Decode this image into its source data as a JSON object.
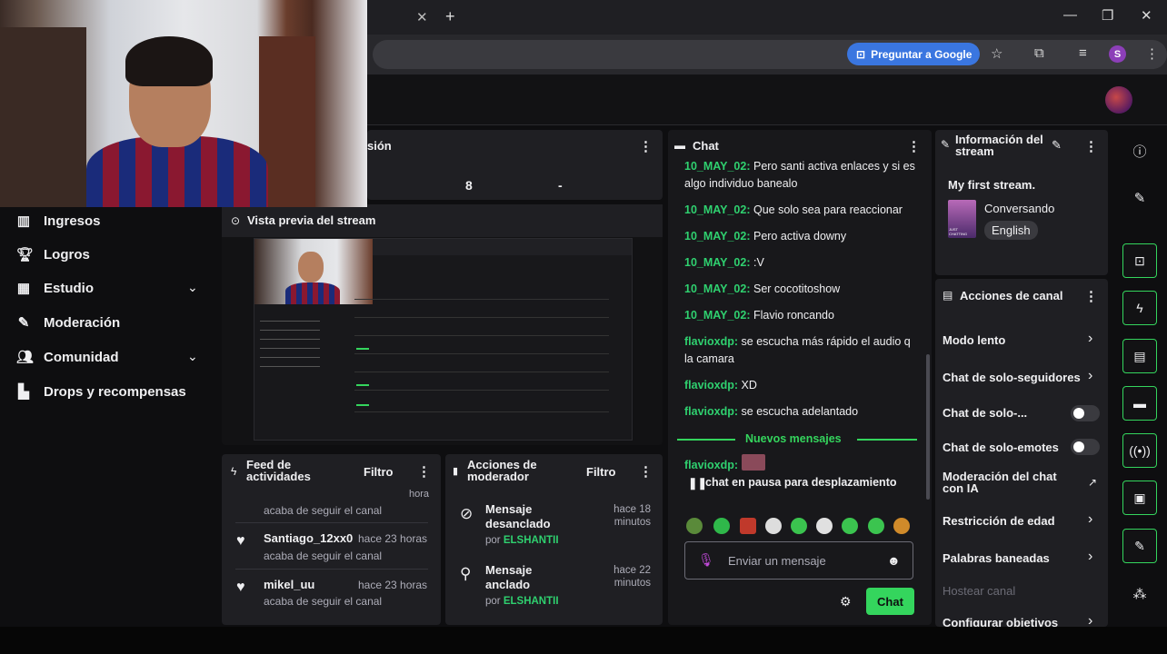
{
  "browser": {
    "tab_close": "✕",
    "tab_new": "+",
    "ask_google": "Preguntar a Google",
    "profile_initial": "S",
    "win_minimize": "—",
    "win_restore": "❐",
    "win_close": "✕"
  },
  "nav": {
    "items": [
      {
        "label": "Ingresos",
        "icon": "bar-chart-icon"
      },
      {
        "label": "Logros",
        "icon": "trophy-icon"
      },
      {
        "label": "Estudio",
        "icon": "studio-icon"
      },
      {
        "label": "Moderación",
        "icon": "wrench-icon"
      },
      {
        "label": "Comunidad",
        "icon": "people-icon"
      },
      {
        "label": "Drops y recompensas",
        "icon": "gift-icon"
      }
    ]
  },
  "session": {
    "title_partial": "sión",
    "stat_a": "8",
    "stat_b": "-"
  },
  "preview": {
    "title": "Vista previa del stream"
  },
  "feed": {
    "title": "Feed de actividades",
    "filter": "Filtro",
    "truncated_time": "hora",
    "first_sub": "acaba de seguir el canal",
    "items": [
      {
        "name": "Santiago_12xx0",
        "time": "hace 23 horas",
        "sub": "acaba de seguir el canal"
      },
      {
        "name": "mikel_uu",
        "time": "hace 23 horas",
        "sub": "acaba de seguir el canal"
      }
    ]
  },
  "modactions": {
    "title": "Acciones de moderador",
    "filter": "Filtro",
    "items": [
      {
        "action": "Mensaje desanclado",
        "time": "hace 18 minutos",
        "by": "por",
        "user": "ELSHANTII"
      },
      {
        "action": "Mensaje anclado",
        "time": "hace 22 minutos",
        "by": "por",
        "user": "ELSHANTII"
      }
    ]
  },
  "chat": {
    "title": "Chat",
    "messages": [
      {
        "name": "10_MAY_02",
        "text": "Pero santi activa enlaces y si es algo individuo banealo"
      },
      {
        "name": "10_MAY_02",
        "text": "Que solo sea para reaccionar"
      },
      {
        "name": "10_MAY_02",
        "text": "Pero activa downy"
      },
      {
        "name": "10_MAY_02",
        "text": ":V"
      },
      {
        "name": "10_MAY_02",
        "text": "Ser cocotitoshow"
      },
      {
        "name": "10_MAY_02",
        "text": "Flavio roncando"
      },
      {
        "name": "flavioxdp",
        "text": "se escucha más rápido el audio q la camara"
      },
      {
        "name": "flavioxdp",
        "text": "XD"
      },
      {
        "name": "flavioxdp",
        "text": "se escucha adelantado"
      }
    ],
    "new_messages": "Nuevos mensajes",
    "last_name": "flavioxdp:",
    "paused": "chat en pausa para desplazamiento",
    "input_placeholder": "Enviar un mensaje",
    "send": "Chat"
  },
  "streaminfo": {
    "title": "Información del stream",
    "stream_title": "My first stream.",
    "category": "Conversando",
    "language": "English",
    "boxart_text": "JUST CHATTING"
  },
  "channel_actions": {
    "title": "Acciones de canal",
    "items": [
      {
        "label": "Modo lento",
        "control": "arrow"
      },
      {
        "label": "Chat de solo-seguidores",
        "control": "arrow"
      },
      {
        "label": "Chat de solo-...",
        "control": "toggle"
      },
      {
        "label": "Chat de solo-emotes",
        "control": "toggle"
      },
      {
        "label": "Moderación del chat con IA",
        "control": "external"
      },
      {
        "label": "Restricción de edad",
        "control": "arrow"
      },
      {
        "label": "Palabras baneadas",
        "control": "arrow"
      },
      {
        "label": "Hostear canal",
        "control": "none"
      },
      {
        "label": "Configurar objetivos",
        "control": "arrow"
      }
    ]
  },
  "colors": {
    "accent": "#34d55d",
    "chat_name": "#2fd06f",
    "panel": "#1f1f23"
  }
}
